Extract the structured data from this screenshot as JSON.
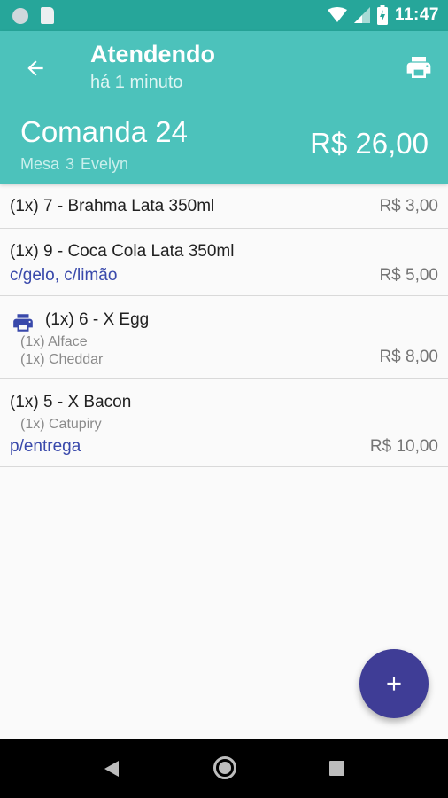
{
  "status_bar": {
    "time": "11:47"
  },
  "app_bar": {
    "title": "Atendendo",
    "subtitle": "há 1 minuto",
    "comanda": "Comanda 24",
    "mesa": "Mesa 3  Evelyn",
    "total": "R$ 26,00"
  },
  "items": [
    {
      "name": "(1x) 7 - Brahma Lata 350ml",
      "price": "R$ 3,00"
    },
    {
      "name": "(1x) 9 - Coca Cola Lata 350ml",
      "note": "c/gelo, c/limão",
      "price": "R$ 5,00"
    },
    {
      "name": "(1x) 6 - X Egg",
      "printed": true,
      "extras": [
        "(1x) Alface",
        "(1x) Cheddar"
      ],
      "price": "R$ 8,00"
    },
    {
      "name": "(1x) 5 - X Bacon",
      "extras": [
        "(1x) Catupiry"
      ],
      "note": "p/entrega",
      "price": "R$ 10,00"
    }
  ],
  "colors": {
    "primary": "#4cc2bb",
    "status_bar": "#26a69a",
    "fab": "#3f3d96",
    "note": "#3949ab"
  },
  "icons": {
    "back": "arrow-back-icon",
    "print": "print-icon",
    "add": "add-icon"
  }
}
